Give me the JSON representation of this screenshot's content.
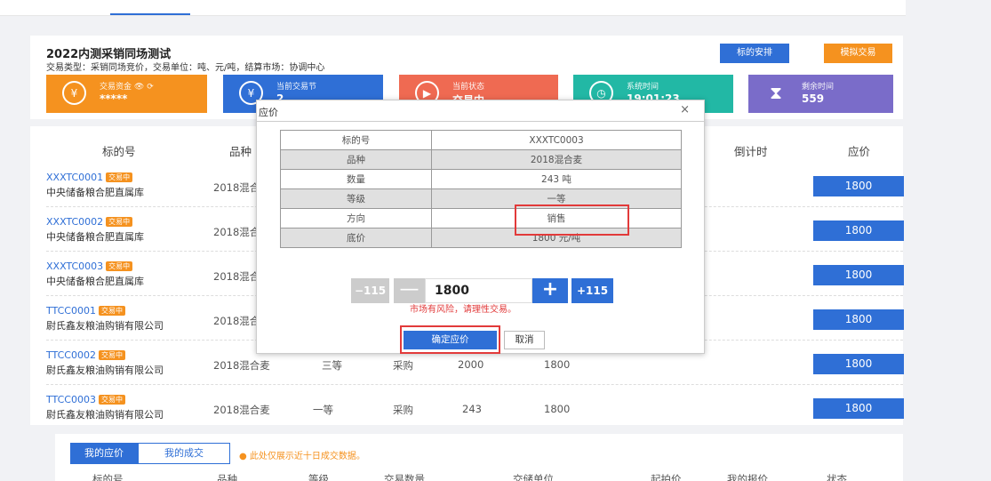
{
  "header": {
    "title": "2022内测采销同场测试",
    "subtitle": "交易类型：采销同场竞价，交易单位：吨、元/吨，结算市场：协调中心",
    "btn_arrangement": "标的安排",
    "btn_simulate": "模拟交易"
  },
  "stats": [
    {
      "label": "交易资金",
      "value": "*****",
      "icon": "money-bag-icon",
      "color": "#f5921f"
    },
    {
      "label": "当前交易节",
      "value": "2",
      "icon": "yen-coin-icon",
      "color": "#2f6fd6"
    },
    {
      "label": "当前状态",
      "value": "交易中",
      "icon": "play-circle-icon",
      "color": "#ef6a52"
    },
    {
      "label": "系统时间",
      "value": "19:01:23",
      "icon": "alarm-clock-icon",
      "color": "#22b8a5"
    },
    {
      "label": "剩余时间",
      "value": "559",
      "icon": "hourglass-icon",
      "color": "#7a6cc9"
    }
  ],
  "table": {
    "headers": {
      "code": "标的号",
      "variety": "品种",
      "countdown": "倒计时",
      "bid": "应价"
    },
    "rows": [
      {
        "code": "XXXTC0001",
        "badge": "交易中",
        "warehouse": "中央储备粮合肥直属库",
        "variety": "2018混合麦",
        "grade": "",
        "direction": "",
        "qty": "",
        "price": "",
        "bid": "1800"
      },
      {
        "code": "XXXTC0002",
        "badge": "交易中",
        "warehouse": "中央储备粮合肥直属库",
        "variety": "2018混合麦",
        "grade": "",
        "direction": "",
        "qty": "",
        "price": "",
        "bid": "1800"
      },
      {
        "code": "XXXTC0003",
        "badge": "交易中",
        "warehouse": "中央储备粮合肥直属库",
        "variety": "2018混合麦",
        "grade": "",
        "direction": "",
        "qty": "",
        "price": "",
        "bid": "1800"
      },
      {
        "code": "TTCC0001",
        "badge": "交易中",
        "warehouse": "尉氏鑫友粮油购销有限公司",
        "variety": "2018混合麦",
        "grade": "",
        "direction": "",
        "qty": "",
        "price": "",
        "bid": "1800"
      },
      {
        "code": "TTCC0002",
        "badge": "交易中",
        "warehouse": "尉氏鑫友粮油购销有限公司",
        "variety": "2018混合麦",
        "grade": "三等",
        "direction": "采购",
        "qty": "2000",
        "price": "1800",
        "bid": "1800"
      },
      {
        "code": "TTCC0003",
        "badge": "交易中",
        "warehouse": "尉氏鑫友粮油购销有限公司",
        "variety": "2018混合麦",
        "grade": "一等",
        "direction": "采购",
        "qty": "243",
        "price": "1800",
        "bid": "1800"
      }
    ]
  },
  "bottom": {
    "tab_my_bids": "我的应价",
    "tab_my_deals": "我的成交",
    "tip": "此处仅展示近十日成交数据。",
    "headers": [
      "标的号",
      "品种",
      "等级",
      "交易数量",
      "交储单位",
      "起拍价",
      "我的报价",
      "状态"
    ]
  },
  "modal": {
    "title": "应价",
    "close": "×",
    "info": [
      {
        "key": "标的号",
        "value": "XXXTC0003"
      },
      {
        "key": "品种",
        "value": "2018混合麦"
      },
      {
        "key": "数量",
        "value": "243 吨"
      },
      {
        "key": "等级",
        "value": "一等"
      },
      {
        "key": "方向",
        "value": "销售"
      },
      {
        "key": "底价",
        "value": "1800 元/吨"
      }
    ],
    "step_minus_big": "−115",
    "step_minus": "—",
    "price_value": "1800",
    "step_plus": "+",
    "step_plus_big": "+115",
    "risk": "市场有风险，请理性交易。",
    "confirm": "确定应价",
    "cancel": "取消"
  }
}
